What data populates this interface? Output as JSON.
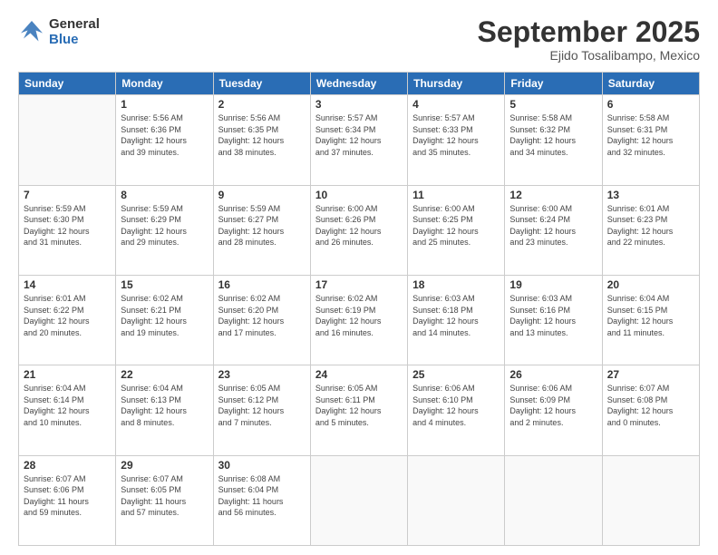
{
  "header": {
    "logo_line1": "General",
    "logo_line2": "Blue",
    "month": "September 2025",
    "location": "Ejido Tosalibampo, Mexico"
  },
  "weekdays": [
    "Sunday",
    "Monday",
    "Tuesday",
    "Wednesday",
    "Thursday",
    "Friday",
    "Saturday"
  ],
  "weeks": [
    [
      {
        "day": "",
        "info": ""
      },
      {
        "day": "1",
        "info": "Sunrise: 5:56 AM\nSunset: 6:36 PM\nDaylight: 12 hours\nand 39 minutes."
      },
      {
        "day": "2",
        "info": "Sunrise: 5:56 AM\nSunset: 6:35 PM\nDaylight: 12 hours\nand 38 minutes."
      },
      {
        "day": "3",
        "info": "Sunrise: 5:57 AM\nSunset: 6:34 PM\nDaylight: 12 hours\nand 37 minutes."
      },
      {
        "day": "4",
        "info": "Sunrise: 5:57 AM\nSunset: 6:33 PM\nDaylight: 12 hours\nand 35 minutes."
      },
      {
        "day": "5",
        "info": "Sunrise: 5:58 AM\nSunset: 6:32 PM\nDaylight: 12 hours\nand 34 minutes."
      },
      {
        "day": "6",
        "info": "Sunrise: 5:58 AM\nSunset: 6:31 PM\nDaylight: 12 hours\nand 32 minutes."
      }
    ],
    [
      {
        "day": "7",
        "info": "Sunrise: 5:59 AM\nSunset: 6:30 PM\nDaylight: 12 hours\nand 31 minutes."
      },
      {
        "day": "8",
        "info": "Sunrise: 5:59 AM\nSunset: 6:29 PM\nDaylight: 12 hours\nand 29 minutes."
      },
      {
        "day": "9",
        "info": "Sunrise: 5:59 AM\nSunset: 6:27 PM\nDaylight: 12 hours\nand 28 minutes."
      },
      {
        "day": "10",
        "info": "Sunrise: 6:00 AM\nSunset: 6:26 PM\nDaylight: 12 hours\nand 26 minutes."
      },
      {
        "day": "11",
        "info": "Sunrise: 6:00 AM\nSunset: 6:25 PM\nDaylight: 12 hours\nand 25 minutes."
      },
      {
        "day": "12",
        "info": "Sunrise: 6:00 AM\nSunset: 6:24 PM\nDaylight: 12 hours\nand 23 minutes."
      },
      {
        "day": "13",
        "info": "Sunrise: 6:01 AM\nSunset: 6:23 PM\nDaylight: 12 hours\nand 22 minutes."
      }
    ],
    [
      {
        "day": "14",
        "info": "Sunrise: 6:01 AM\nSunset: 6:22 PM\nDaylight: 12 hours\nand 20 minutes."
      },
      {
        "day": "15",
        "info": "Sunrise: 6:02 AM\nSunset: 6:21 PM\nDaylight: 12 hours\nand 19 minutes."
      },
      {
        "day": "16",
        "info": "Sunrise: 6:02 AM\nSunset: 6:20 PM\nDaylight: 12 hours\nand 17 minutes."
      },
      {
        "day": "17",
        "info": "Sunrise: 6:02 AM\nSunset: 6:19 PM\nDaylight: 12 hours\nand 16 minutes."
      },
      {
        "day": "18",
        "info": "Sunrise: 6:03 AM\nSunset: 6:18 PM\nDaylight: 12 hours\nand 14 minutes."
      },
      {
        "day": "19",
        "info": "Sunrise: 6:03 AM\nSunset: 6:16 PM\nDaylight: 12 hours\nand 13 minutes."
      },
      {
        "day": "20",
        "info": "Sunrise: 6:04 AM\nSunset: 6:15 PM\nDaylight: 12 hours\nand 11 minutes."
      }
    ],
    [
      {
        "day": "21",
        "info": "Sunrise: 6:04 AM\nSunset: 6:14 PM\nDaylight: 12 hours\nand 10 minutes."
      },
      {
        "day": "22",
        "info": "Sunrise: 6:04 AM\nSunset: 6:13 PM\nDaylight: 12 hours\nand 8 minutes."
      },
      {
        "day": "23",
        "info": "Sunrise: 6:05 AM\nSunset: 6:12 PM\nDaylight: 12 hours\nand 7 minutes."
      },
      {
        "day": "24",
        "info": "Sunrise: 6:05 AM\nSunset: 6:11 PM\nDaylight: 12 hours\nand 5 minutes."
      },
      {
        "day": "25",
        "info": "Sunrise: 6:06 AM\nSunset: 6:10 PM\nDaylight: 12 hours\nand 4 minutes."
      },
      {
        "day": "26",
        "info": "Sunrise: 6:06 AM\nSunset: 6:09 PM\nDaylight: 12 hours\nand 2 minutes."
      },
      {
        "day": "27",
        "info": "Sunrise: 6:07 AM\nSunset: 6:08 PM\nDaylight: 12 hours\nand 0 minutes."
      }
    ],
    [
      {
        "day": "28",
        "info": "Sunrise: 6:07 AM\nSunset: 6:06 PM\nDaylight: 11 hours\nand 59 minutes."
      },
      {
        "day": "29",
        "info": "Sunrise: 6:07 AM\nSunset: 6:05 PM\nDaylight: 11 hours\nand 57 minutes."
      },
      {
        "day": "30",
        "info": "Sunrise: 6:08 AM\nSunset: 6:04 PM\nDaylight: 11 hours\nand 56 minutes."
      },
      {
        "day": "",
        "info": ""
      },
      {
        "day": "",
        "info": ""
      },
      {
        "day": "",
        "info": ""
      },
      {
        "day": "",
        "info": ""
      }
    ]
  ]
}
